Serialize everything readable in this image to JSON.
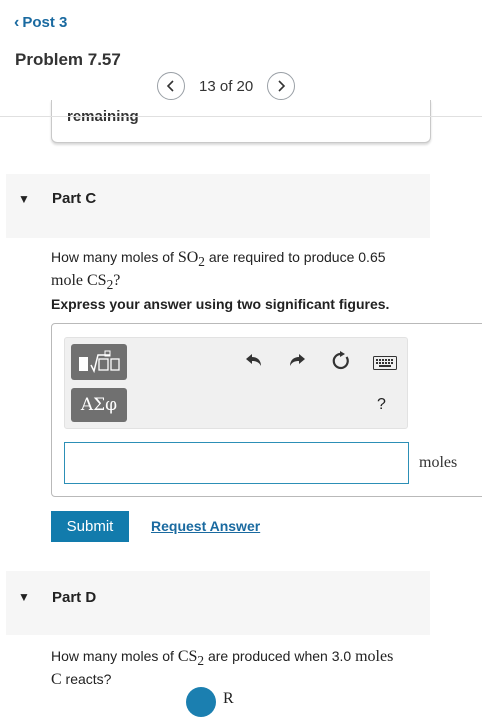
{
  "header": {
    "back_label": "Post 3",
    "problem_title": "Problem 7.57",
    "pager_text": "13 of 20"
  },
  "remaining_card": {
    "text": "remaining"
  },
  "part_c": {
    "label": "Part C",
    "q_prefix": "How many moles of ",
    "q_so2": "SO",
    "q_so2_sub": "2",
    "q_mid": " are required to produce 0.65",
    "q_mole": "mole CS",
    "q_cs2_sub": "2",
    "q_end": "?",
    "instruction": "Express your answer using two significant figures.",
    "greek_button": "ΑΣφ",
    "help_label": "?",
    "answer_value": "",
    "units": "moles",
    "submit_label": "Submit",
    "request_label": "Request Answer"
  },
  "part_d": {
    "label": "Part D",
    "q_prefix": "How many moles of ",
    "q_cs2": "CS",
    "q_cs2_sub": "2",
    "q_mid": " are produced when 3.0 ",
    "q_moles": "moles",
    "q_c": "C",
    "q_end": " reacts?",
    "review_partial": "R"
  }
}
